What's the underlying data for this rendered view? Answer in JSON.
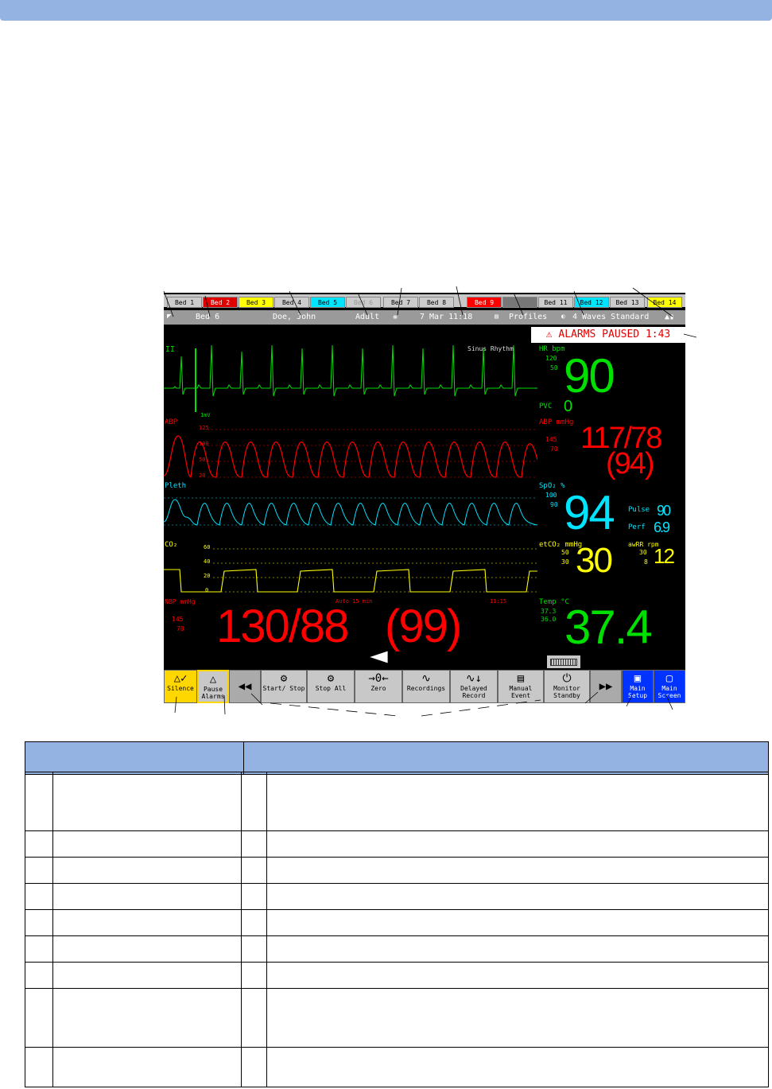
{
  "beds": [
    "Bed 1",
    "Bed 2",
    "Bed 3",
    "Bed 4",
    "Bed 5",
    "Bed 6",
    "Bed 7",
    "Bed 8",
    "Bed 9",
    "",
    "Bed 11",
    "Bed 12",
    "Bed 13",
    "Bed 14"
  ],
  "info": {
    "bed": "Bed 6",
    "patient": "Doe, John",
    "category": "Adult",
    "datetime": "7 Mar 11:18",
    "profiles": "Profiles",
    "screen": "4 Waves Standard"
  },
  "alarm_banner": "ALARMS PAUSED 1:43",
  "waves": {
    "ecg": {
      "label": "II",
      "rhythm": "Sinus Rhythm",
      "scale": "1mV"
    },
    "abp": {
      "label": "ABP",
      "ticks": [
        "125",
        "100",
        "50",
        "20"
      ]
    },
    "pleth": {
      "label": "Pleth"
    },
    "co2": {
      "label": "CO₂",
      "ticks": [
        "60",
        "40",
        "20",
        "0"
      ]
    }
  },
  "numerics": {
    "hr": {
      "label": "HR bpm",
      "hi": "120",
      "lo": "50",
      "value": "90"
    },
    "pvc": {
      "label": "PVC",
      "value": "0"
    },
    "abp": {
      "label": "ABP mmHg",
      "hi": "145",
      "lo": "70",
      "value": "117/78",
      "mean": "(94)"
    },
    "spo2": {
      "label": "SpO₂ %",
      "hi": "100",
      "lo": "90",
      "value": "94"
    },
    "pulse": {
      "label": "Pulse",
      "value": "90"
    },
    "perf": {
      "label": "Perf",
      "value": "6.9"
    },
    "etco2": {
      "label": "etCO₂ mmHg",
      "hi": "50",
      "lo": "30",
      "value": "30"
    },
    "awrr": {
      "label": "awRR rpm",
      "hi": "30",
      "lo": "8",
      "value": "12"
    },
    "nbp": {
      "label": "NBP mmHg",
      "hi": "145",
      "lo": "70",
      "mode": "Auto 15 min",
      "time": "11:15",
      "value": "130/88",
      "mean": "(99)"
    },
    "temp": {
      "label": "Temp °C",
      "hi": "37.3",
      "lo": "36.0",
      "value": "37.4"
    }
  },
  "keys": [
    {
      "label": "Silence",
      "icon": "silence-icon"
    },
    {
      "label": "Pause Alarms",
      "icon": "pause-alarms-icon"
    },
    {
      "label": "",
      "icon": "scroll-left-icon"
    },
    {
      "label": "Start/ Stop",
      "icon": "start-stop-icon"
    },
    {
      "label": "Stop All",
      "icon": "stop-all-icon"
    },
    {
      "label": "Zero",
      "icon": "zero-icon"
    },
    {
      "label": "Recordings",
      "icon": "recordings-icon"
    },
    {
      "label": "Delayed Record",
      "icon": "delayed-record-icon"
    },
    {
      "label": "Manual Event",
      "icon": "manual-event-icon"
    },
    {
      "label": "Monitor Standby",
      "icon": "standby-icon"
    },
    {
      "label": "",
      "icon": "scroll-right-icon"
    },
    {
      "label": "Main Setup",
      "icon": "main-setup-icon"
    },
    {
      "label": "Main Screen",
      "icon": "main-screen-icon"
    }
  ],
  "colors": {
    "header": "#95b3e2",
    "ecg": "#00e000",
    "abp": "#ff0000",
    "spo2": "#00e5ff",
    "co2": "#ffff00",
    "silence": "#ffd700",
    "main_keys": "#0033ff"
  }
}
